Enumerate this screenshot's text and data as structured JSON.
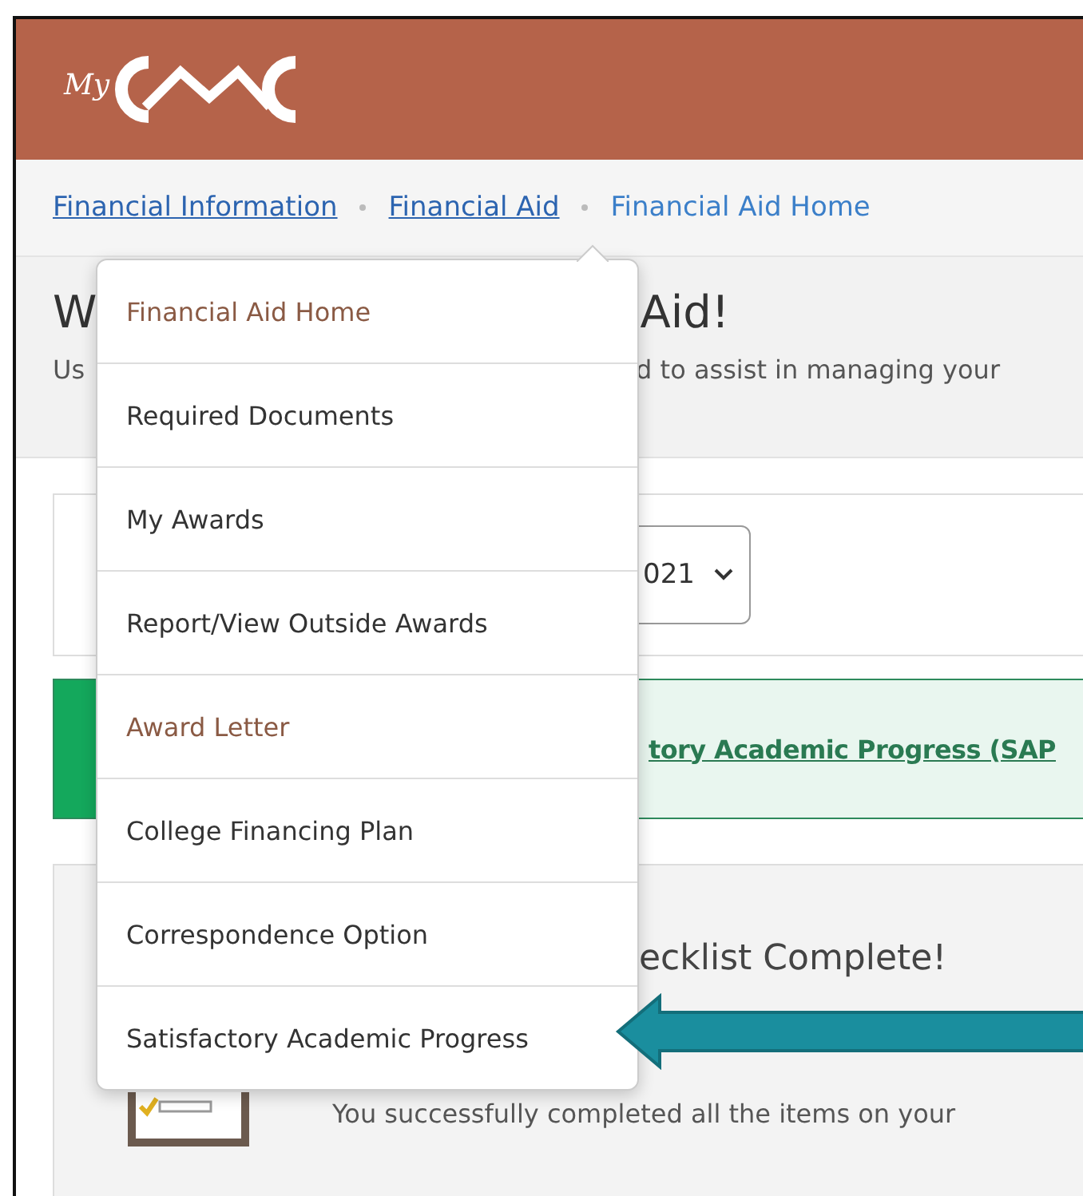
{
  "header": {
    "logo_prefix": "My"
  },
  "breadcrumb": [
    {
      "label": "Financial Information",
      "kind": "link"
    },
    {
      "label": "Financial Aid",
      "kind": "link"
    },
    {
      "label": "Financial Aid Home",
      "kind": "current"
    }
  ],
  "hero": {
    "title_start": "W",
    "title_end": "Aid!",
    "subtitle_start": "Us",
    "subtitle_end": "d to assist in managing your"
  },
  "year_select": {
    "value": "021"
  },
  "alert": {
    "link": "tory Academic Progress (SAP"
  },
  "checklist_card": {
    "title": "ecklist Complete!",
    "message": "You successfully completed all the items on your"
  },
  "dropdown": {
    "items": [
      {
        "label": "Financial Aid Home",
        "visited": true
      },
      {
        "label": "Required Documents",
        "visited": false
      },
      {
        "label": "My Awards",
        "visited": false
      },
      {
        "label": "Report/View Outside Awards",
        "visited": false
      },
      {
        "label": "Award Letter",
        "visited": true
      },
      {
        "label": "College Financing Plan",
        "visited": false
      },
      {
        "label": "Correspondence Option",
        "visited": false
      },
      {
        "label": "Satisfactory Academic Progress",
        "visited": false
      }
    ]
  }
}
